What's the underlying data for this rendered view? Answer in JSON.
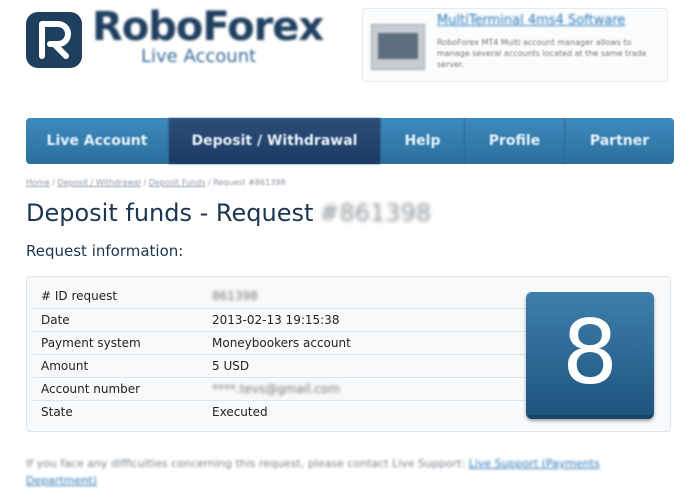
{
  "logo": {
    "name": "RoboForex",
    "subtitle": "Live Account"
  },
  "promo": {
    "title": "MultiTerminal 4ms4 Software",
    "text": "RoboForex MT4 Multi account manager allows to manage several accounts located at the same trade server."
  },
  "nav": {
    "items": [
      {
        "label": "Live Account"
      },
      {
        "label": "Deposit / Withdrawal"
      },
      {
        "label": "Help"
      },
      {
        "label": "Profile"
      },
      {
        "label": "Partner"
      }
    ],
    "active_index": 1
  },
  "breadcrumb": {
    "items": [
      "Home",
      "Deposit / Withdrawal",
      "Deposit Funds",
      "Request #861398"
    ],
    "separator": "/"
  },
  "page": {
    "title": "Deposit funds - Request",
    "title_id": "#861398",
    "section_title": "Request information:"
  },
  "request": {
    "rows": [
      {
        "label": "# ID request",
        "value": "861398"
      },
      {
        "label": "Date",
        "value": "2013-02-13 19:15:38"
      },
      {
        "label": "Payment system",
        "value": "Moneybookers account"
      },
      {
        "label": "Amount",
        "value": "5 USD"
      },
      {
        "label": "Account number",
        "value": "****.tevs@gmail.com"
      },
      {
        "label": "State",
        "value": "Executed"
      }
    ]
  },
  "step_badge": {
    "number": "8"
  },
  "footer": {
    "text": "If you face any difficulties concerning this request, please contact Live Support:",
    "link": "Live Support (Payments Department)"
  },
  "colors": {
    "nav": "#2f78a9",
    "nav_active": "#213f68",
    "badge": "#2a6894",
    "link": "#2b79b8"
  }
}
